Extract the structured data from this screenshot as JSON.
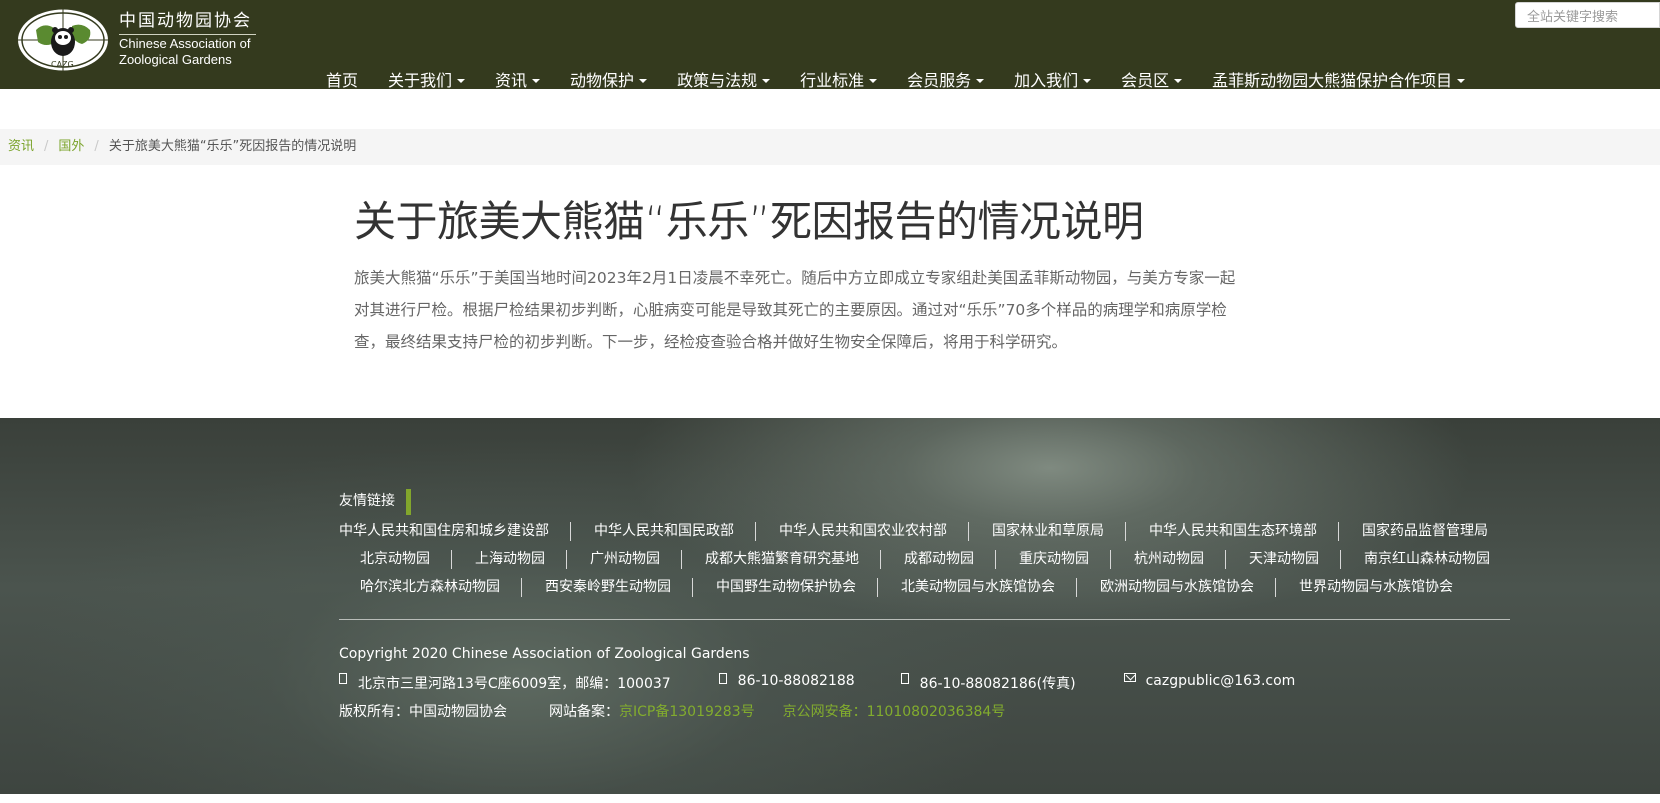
{
  "header": {
    "logo_cn": "中国动物园协会",
    "logo_en_line1": "Chinese Association of",
    "logo_en_line2": "Zoological Gardens",
    "logo_badge_text": "CAZG",
    "search_placeholder": "全站关键字搜索",
    "nav": [
      {
        "label": "首页",
        "dropdown": false
      },
      {
        "label": "关于我们",
        "dropdown": true
      },
      {
        "label": "资讯",
        "dropdown": true
      },
      {
        "label": "动物保护",
        "dropdown": true
      },
      {
        "label": "政策与法规",
        "dropdown": true
      },
      {
        "label": "行业标准",
        "dropdown": true
      },
      {
        "label": "会员服务",
        "dropdown": true
      },
      {
        "label": "加入我们",
        "dropdown": true
      },
      {
        "label": "会员区",
        "dropdown": true
      },
      {
        "label": "孟菲斯动物园大熊猫保护合作项目",
        "dropdown": true
      }
    ]
  },
  "breadcrumb": {
    "items": [
      "资讯",
      "国外"
    ],
    "separator": "/",
    "current": "关于旅美大熊猫“乐乐”死因报告的情况说明"
  },
  "article": {
    "title": "关于旅美大熊猫“乐乐”死因报告的情况说明",
    "body_lines": [
      "旅美大熊猫“乐乐”于美国当地时间2023年2月1日凌晨不幸死亡。随后中方立即成立专家组赴美国孟菲斯动物园，与美方专家一起",
      "对其进行尸检。根据尸检结果初步判断，心脏病变可能是导致其死亡的主要原因。通过对“乐乐”70多个样品的病理学和病原学检",
      "查，最终结果支持尸检的初步判断。下一步，经检疫查验合格并做好生物安全保障后，将用于科学研究。"
    ]
  },
  "footer": {
    "links_title": "友情链接",
    "link_rows": [
      [
        "中华人民共和国住房和城乡建设部",
        "中华人民共和国民政部",
        "中华人民共和国农业农村部",
        "国家林业和草原局",
        "中华人民共和国生态环境部",
        "国家药品监督管理局"
      ],
      [
        "北京动物园",
        "上海动物园",
        "广州动物园",
        "成都大熊猫繁育研究基地",
        "成都动物园",
        "重庆动物园",
        "杭州动物园",
        "天津动物园",
        "南京红山森林动物园"
      ],
      [
        "哈尔滨北方森林动物园",
        "西安秦岭野生动物园",
        "中国野生动物保护协会",
        "北美动物园与水族馆协会",
        "欧洲动物园与水族馆协会",
        "世界动物园与水族馆协会"
      ]
    ],
    "copyright": "Copyright 2020 Chinese Association of Zoological Gardens",
    "address": "北京市三里河路13号C座6009室，邮编：100037",
    "phone": "86-10-88082188",
    "fax": "86-10-88082186(传真)",
    "email": "cazgpublic@163.com",
    "rights": "版权所有：中国动物园协会",
    "record_label": "网站备案：",
    "icp": "京ICP备13019283号",
    "police_record": "京公网安备：11010802036384号"
  },
  "colors": {
    "header_bg": "#343a1e",
    "accent_green": "#82a62c",
    "link_green": "#7aa32a"
  }
}
